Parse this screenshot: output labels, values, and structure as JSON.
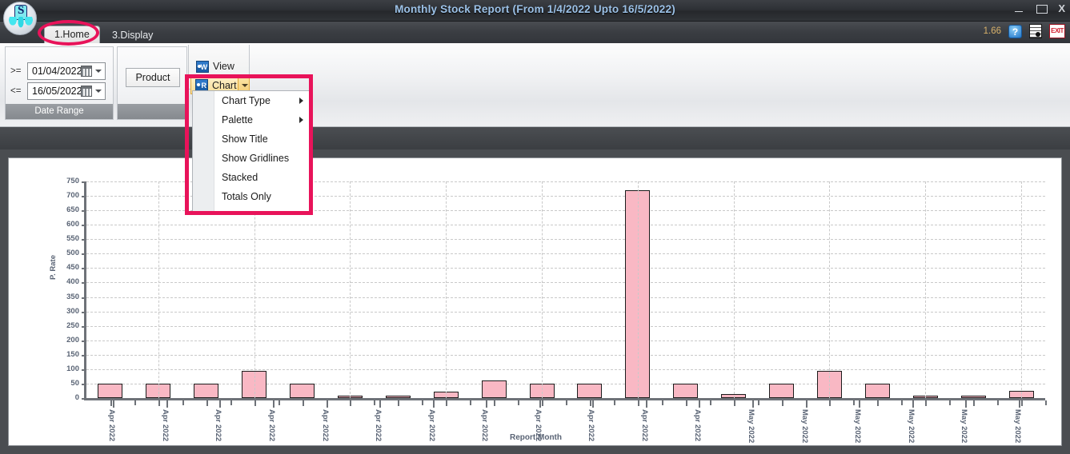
{
  "window": {
    "title": "Monthly Stock Report (From 1/4/2022 Upto 16/5/2022)",
    "minimize_label": "",
    "maximize_label": "",
    "close_label": "X"
  },
  "header": {
    "version": "1.66",
    "help_label": "?",
    "doc_icon": "document-icon",
    "exit_label": "EXIT"
  },
  "tabs": [
    {
      "label": "1.Home",
      "active": true
    },
    {
      "label": "3.Display",
      "active": false
    }
  ],
  "ribbon": {
    "date_range": {
      "group_label": "Date Range",
      "from_operator": ">=",
      "from_value": "01/04/2022",
      "to_operator": "<=",
      "to_value": "16/05/2022"
    },
    "product": {
      "button_label": "Product"
    },
    "view_button": "View",
    "chart_button": "Chart"
  },
  "chart_menu": {
    "items": [
      {
        "label": "Chart Type",
        "has_submenu": true
      },
      {
        "label": "Palette",
        "has_submenu": true
      },
      {
        "label": "Show Title",
        "has_submenu": false
      },
      {
        "label": "Show Gridlines",
        "has_submenu": false
      },
      {
        "label": "Stacked",
        "has_submenu": false
      },
      {
        "label": "Totals Only",
        "has_submenu": false
      }
    ]
  },
  "colors": {
    "bar_fill": "#f9b8c4",
    "bar_stroke": "#1c1c1c",
    "highlight": "#e8135a",
    "axis_text": "#5a6475",
    "title_text": "#9cc2e8"
  },
  "chart_data": {
    "type": "bar",
    "title": "",
    "xlabel": "Report Month",
    "ylabel": "P. Rate",
    "ylim": [
      0,
      750
    ],
    "ytick_step": 50,
    "grid": true,
    "legend": "none",
    "categories": [
      "Apr 2022",
      "Apr 2022",
      "Apr 2022",
      "Apr 2022",
      "Apr 2022",
      "Apr 2022",
      "Apr 2022",
      "Apr 2022",
      "Apr 2022",
      "Apr 2022",
      "Apr 2022",
      "Apr 2022",
      "Apr 2022",
      "Apr 2022",
      "Apr 2022",
      "Apr 2022",
      "Apr 2022",
      "Apr 2022",
      "May 2022",
      "May 2022",
      "May 2022",
      "May 2022",
      "May 2022",
      "May 2022",
      "May 2022"
    ],
    "ytick_labels": [
      "750",
      "700",
      "650",
      "600",
      "550",
      "500",
      "450",
      "400",
      "350",
      "300",
      "250",
      "200",
      "150",
      "100",
      "50",
      "0"
    ],
    "xtick_labels_shown": [
      "Apr 2022",
      "Apr 2022",
      "Apr 2022",
      "Apr 2022",
      "Apr 2022",
      "Apr 2022",
      "Apr 2022",
      "Apr 2022",
      "Apr 2022",
      "Apr 2022",
      "Apr 2022",
      "Apr 2022",
      "May 2022",
      "May 2022",
      "May 2022",
      "May 2022",
      "May 2022",
      "May 2022"
    ],
    "values": [
      50,
      50,
      50,
      95,
      50,
      8,
      8,
      22,
      60,
      50,
      50,
      720,
      50,
      15,
      50,
      95,
      50,
      8,
      8,
      25
    ]
  }
}
